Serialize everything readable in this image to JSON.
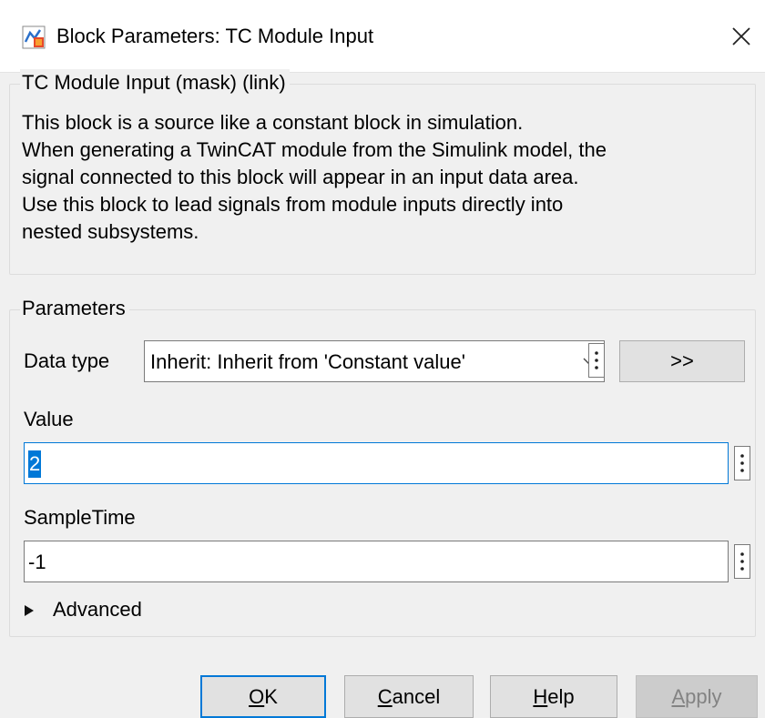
{
  "window": {
    "title": "Block Parameters: TC Module Input",
    "icon": "simulink-block-icon",
    "close_icon": "close-icon"
  },
  "description_group": {
    "legend": "TC Module Input (mask) (link)",
    "lines": [
      "This block is a source like a constant block in simulation.",
      "When generating a TwinCAT module from the Simulink model, the",
      "signal connected to this block will appear in an input data area.",
      "Use this block to lead signals from module inputs directly into",
      "nested subsystems."
    ]
  },
  "parameters_group": {
    "legend": "Parameters",
    "data_type": {
      "label": "Data type",
      "selected": "Inherit: Inherit from 'Constant value'",
      "assistant_button": ">>"
    },
    "value": {
      "label": "Value",
      "input": "2"
    },
    "sample_time": {
      "label": "SampleTime",
      "input": "-1"
    },
    "advanced": {
      "label": "Advanced",
      "expanded": false
    }
  },
  "buttons": {
    "ok": {
      "pre": "",
      "mnemonic": "O",
      "post": "K"
    },
    "cancel": {
      "pre": "",
      "mnemonic": "C",
      "post": "ancel"
    },
    "help": {
      "pre": "",
      "mnemonic": "H",
      "post": "elp"
    },
    "apply": {
      "pre": "",
      "mnemonic": "A",
      "post": "pply",
      "enabled": false
    }
  },
  "colors": {
    "accent": "#0078d7",
    "background": "#f0f0f0",
    "selection": "#0078d7"
  }
}
